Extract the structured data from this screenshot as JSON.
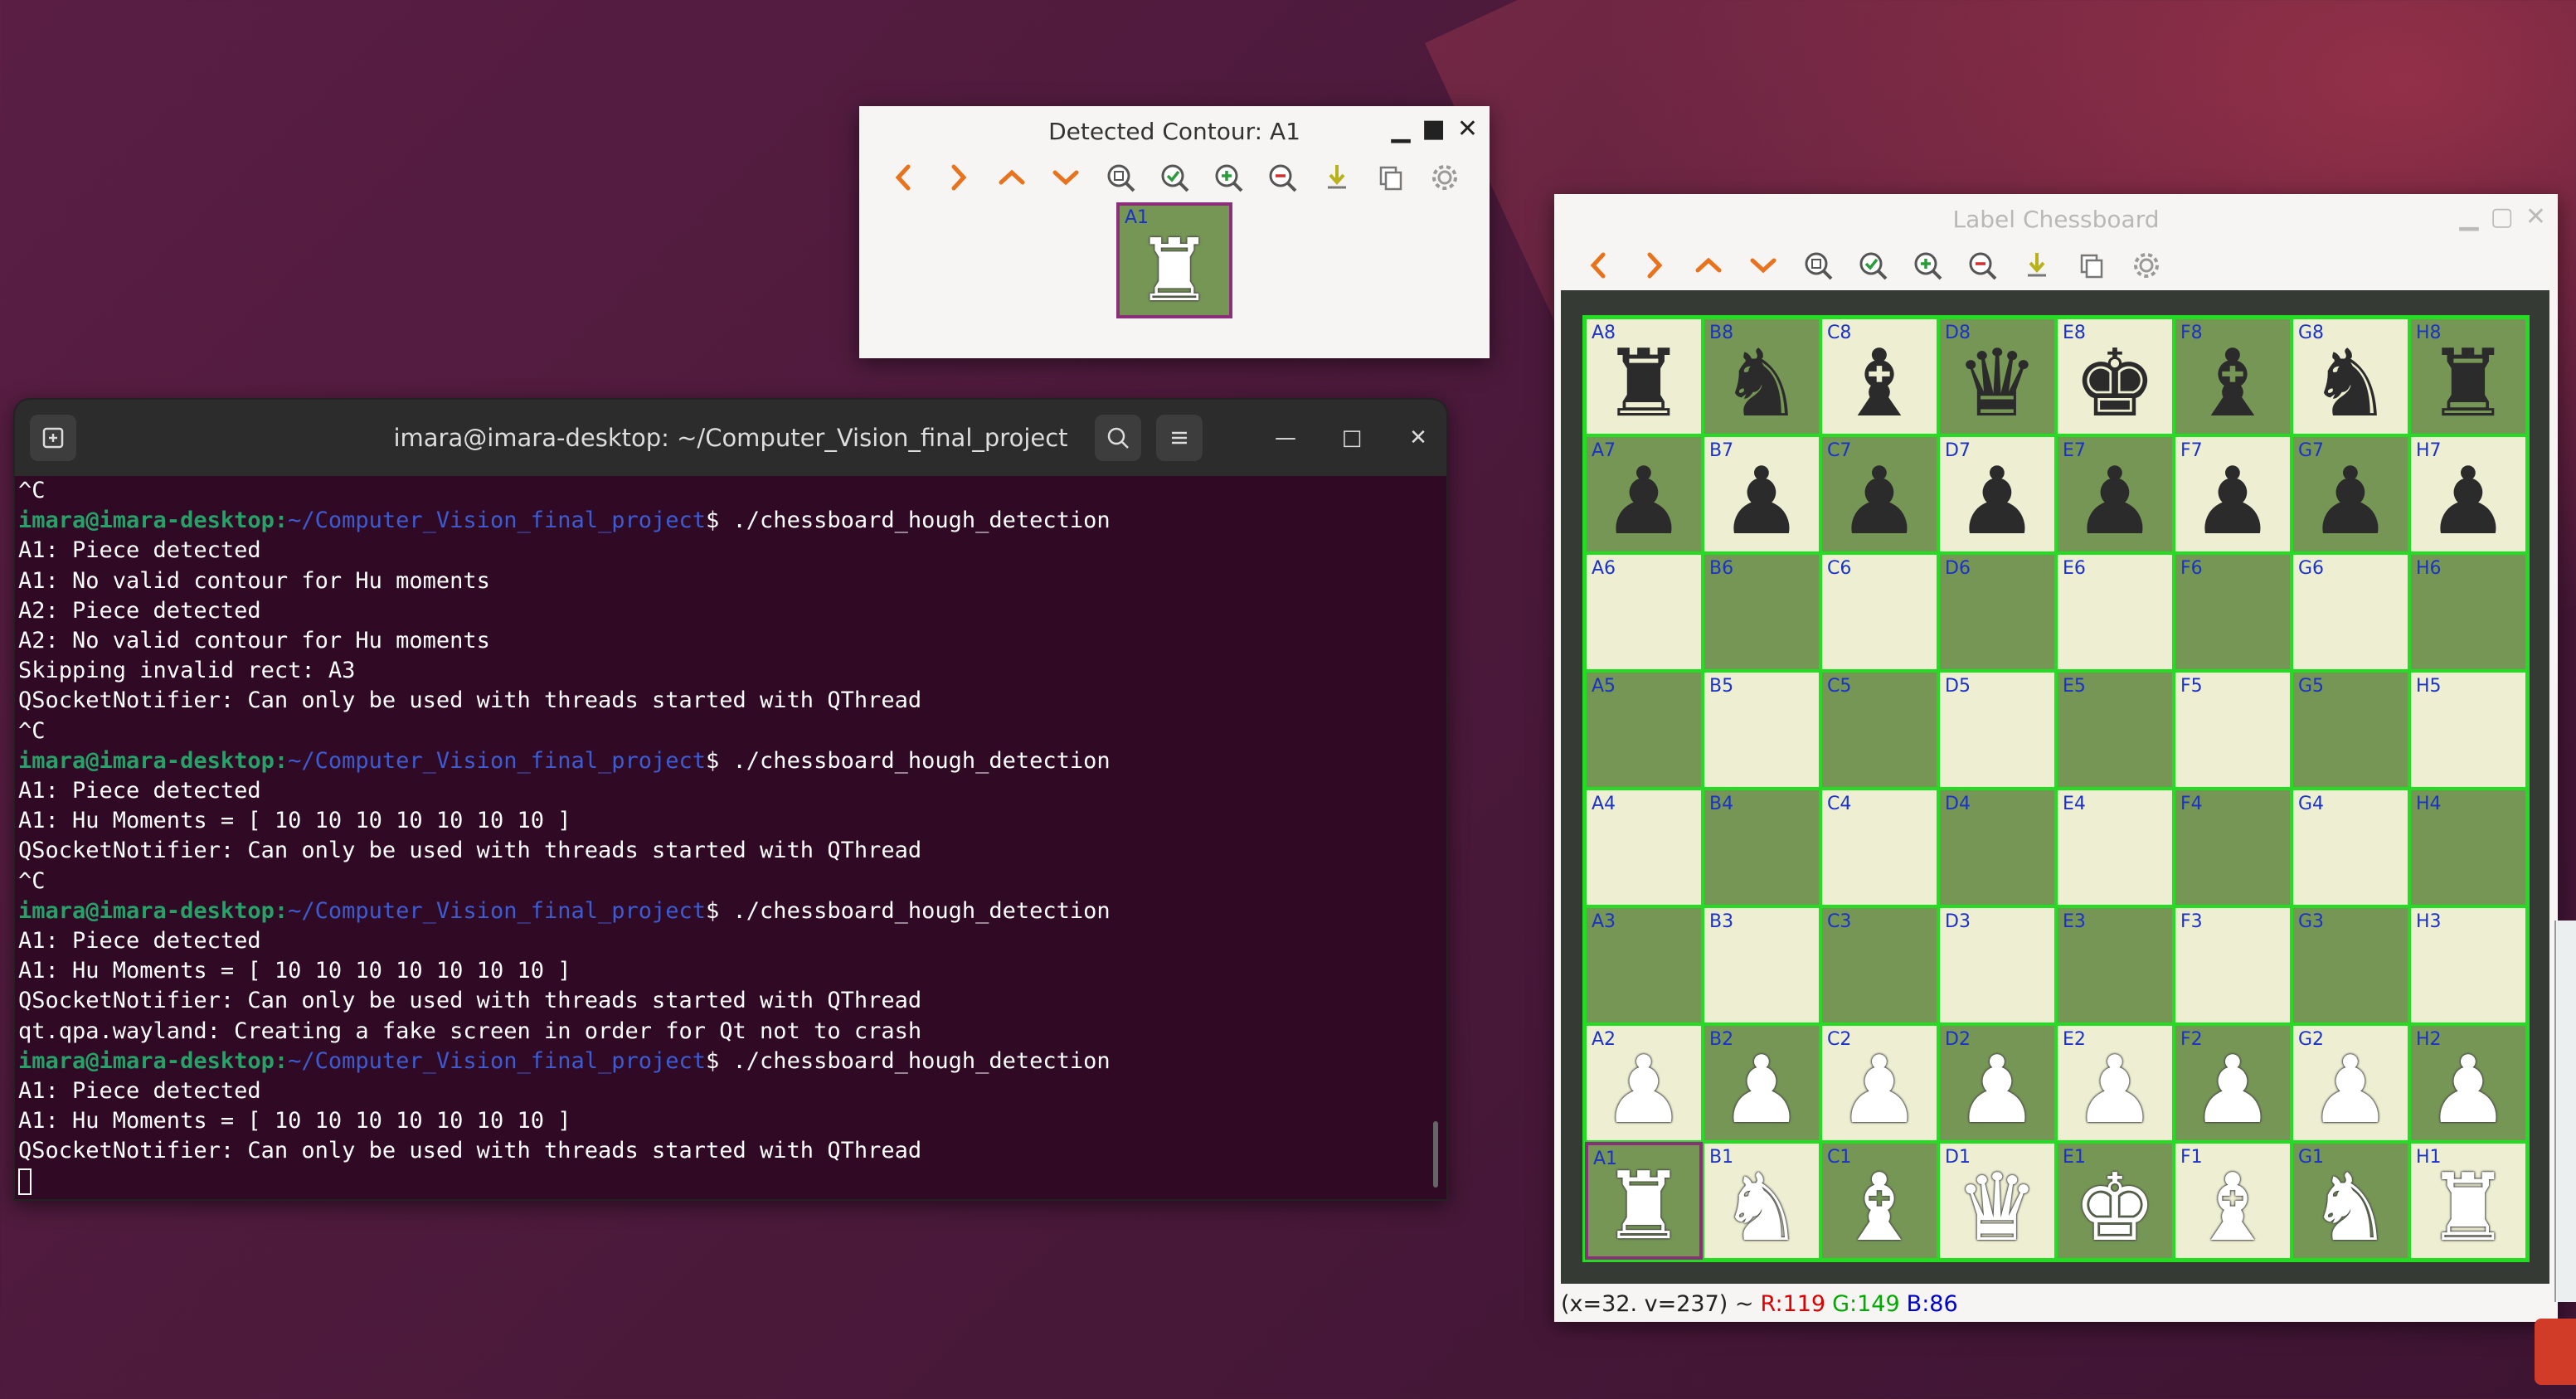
{
  "contour_window": {
    "title": "Detected Contour: A1",
    "thumb_label": "A1",
    "thumb_piece": "♜"
  },
  "toolbar_icons": [
    "arrow-left-icon",
    "arrow-right-icon",
    "arrow-up-icon",
    "arrow-down-icon",
    "zoom-fit-icon",
    "zoom-check-icon",
    "zoom-in-icon",
    "zoom-out-icon",
    "save-icon",
    "copy-icon",
    "gear-icon"
  ],
  "terminal": {
    "title": "imara@imara-desktop: ~/Computer_Vision_final_project",
    "prompt_user": "imara@imara-desktop",
    "prompt_path": "~/Computer_Vision_final_project",
    "lines": [
      {
        "type": "out",
        "text": "^C"
      },
      {
        "type": "cmd",
        "text": "$ ./chessboard_hough_detection"
      },
      {
        "type": "out",
        "text": "A1: Piece detected"
      },
      {
        "type": "out",
        "text": "A1: No valid contour for Hu moments"
      },
      {
        "type": "out",
        "text": "A2: Piece detected"
      },
      {
        "type": "out",
        "text": "A2: No valid contour for Hu moments"
      },
      {
        "type": "out",
        "text": "Skipping invalid rect: A3"
      },
      {
        "type": "out",
        "text": "QSocketNotifier: Can only be used with threads started with QThread"
      },
      {
        "type": "out",
        "text": "^C"
      },
      {
        "type": "cmd",
        "text": "$ ./chessboard_hough_detection"
      },
      {
        "type": "out",
        "text": "A1: Piece detected"
      },
      {
        "type": "out",
        "text": "A1: Hu Moments = [ 10 10 10 10 10 10 10 ]"
      },
      {
        "type": "out",
        "text": "QSocketNotifier: Can only be used with threads started with QThread"
      },
      {
        "type": "out",
        "text": "^C"
      },
      {
        "type": "cmd",
        "text": "$ ./chessboard_hough_detection"
      },
      {
        "type": "out",
        "text": "A1: Piece detected"
      },
      {
        "type": "out",
        "text": "A1: Hu Moments = [ 10 10 10 10 10 10 10 ]"
      },
      {
        "type": "out",
        "text": "QSocketNotifier: Can only be used with threads started with QThread"
      },
      {
        "type": "out",
        "text": "qt.qpa.wayland: Creating a fake screen in order for Qt not to crash"
      },
      {
        "type": "cmd",
        "text": "$ ./chessboard_hough_detection"
      },
      {
        "type": "out",
        "text": "A1: Piece detected"
      },
      {
        "type": "out",
        "text": "A1: Hu Moments = [ 10 10 10 10 10 10 10 ]"
      },
      {
        "type": "out",
        "text": "QSocketNotifier: Can only be used with threads started with QThread"
      }
    ]
  },
  "board_window": {
    "title": "Label Chessboard",
    "ranks": [
      {
        "rank": "8",
        "pieces": [
          "♜",
          "♞",
          "♝",
          "♛",
          "♚",
          "♝",
          "♞",
          "♜"
        ],
        "color": "black"
      },
      {
        "rank": "7",
        "pieces": [
          "♟",
          "♟",
          "♟",
          "♟",
          "♟",
          "♟",
          "♟",
          "♟"
        ],
        "color": "black"
      },
      {
        "rank": "6",
        "pieces": [
          "",
          "",
          "",
          "",
          "",
          "",
          "",
          ""
        ],
        "color": "none"
      },
      {
        "rank": "5",
        "pieces": [
          "",
          "",
          "",
          "",
          "",
          "",
          "",
          ""
        ],
        "color": "none"
      },
      {
        "rank": "4",
        "pieces": [
          "",
          "",
          "",
          "",
          "",
          "",
          "",
          ""
        ],
        "color": "none"
      },
      {
        "rank": "3",
        "pieces": [
          "",
          "",
          "",
          "",
          "",
          "",
          "",
          ""
        ],
        "color": "none"
      },
      {
        "rank": "2",
        "pieces": [
          "♟",
          "♟",
          "♟",
          "♟",
          "♟",
          "♟",
          "♟",
          "♟"
        ],
        "color": "white"
      },
      {
        "rank": "1",
        "pieces": [
          "♜",
          "♞",
          "♝",
          "♛",
          "♚",
          "♝",
          "♞",
          "♜"
        ],
        "color": "white"
      }
    ],
    "files": [
      "A",
      "B",
      "C",
      "D",
      "E",
      "F",
      "G",
      "H"
    ],
    "selected_square": "A1",
    "status": {
      "coords": "(x=32. v=237) ~",
      "r": "R:119",
      "g": "G:149",
      "b": "B:86"
    }
  },
  "colors": {
    "light_square": "#eeeed2",
    "dark_square": "#769656",
    "grid_line": "#22dd22",
    "selection": "#8b2f7a",
    "terminal_bg": "#300a24"
  }
}
